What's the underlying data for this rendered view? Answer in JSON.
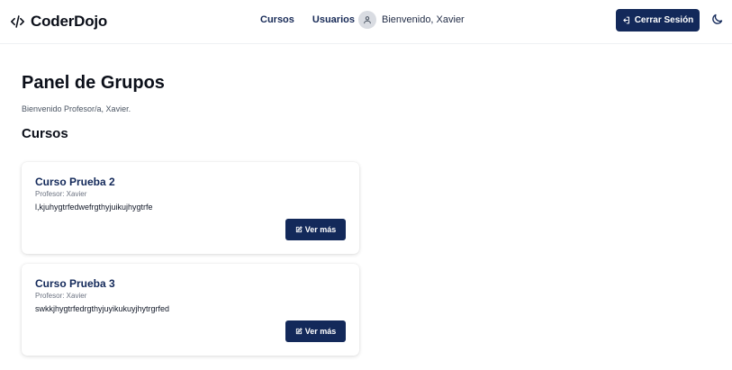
{
  "brand": {
    "icon": "code-icon",
    "name": "CoderDojo"
  },
  "nav": {
    "links": [
      {
        "label": "Cursos"
      },
      {
        "label": "Usuarios"
      }
    ],
    "welcome": "Bienvenido, Xavier",
    "avatar_icon": "user-icon",
    "logout_label": "Cerrar Sesión",
    "logout_icon": "logout-icon",
    "theme_icon": "moon-icon"
  },
  "page": {
    "title": "Panel de Grupos",
    "subtitle": "Bienvenido Profesor/a, Xavier.",
    "section_title": "Cursos"
  },
  "courses": [
    {
      "title": "Curso Prueba 2",
      "teacher": "Profesor: Xavier",
      "description": "l,kjuhygtrfedwefrgthyjuikujhygtrfe",
      "button_label": "Ver más",
      "button_icon": "edit-icon"
    },
    {
      "title": "Curso Prueba 3",
      "teacher": "Profesor: Xavier",
      "description": "swkkjhygtrfedrgthyjuyikukuyjhytrgrfed",
      "button_label": "Ver más",
      "button_icon": "edit-icon"
    }
  ],
  "colors": {
    "primary": "#13295a",
    "text": "#0b0f19",
    "muted": "#6b7280",
    "avatar_bg": "#d9dce2"
  }
}
